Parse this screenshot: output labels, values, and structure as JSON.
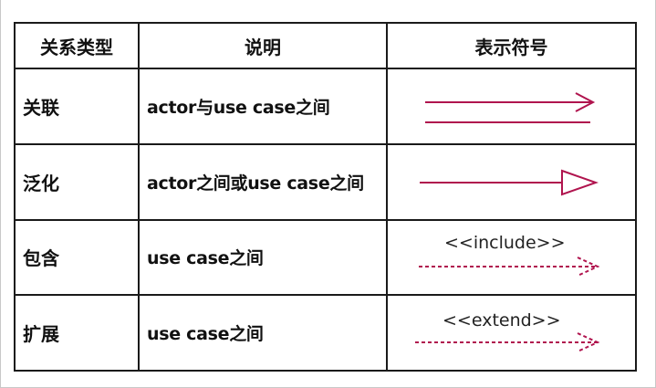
{
  "headers": [
    "关系类型",
    "说明",
    "表示符号"
  ],
  "rows": [
    {
      "type": "关联",
      "desc": "actor与use case之间",
      "symbol": "association",
      "stereotype": ""
    },
    {
      "type": "泛化",
      "desc": "actor之间或use case之间",
      "symbol": "generalization",
      "stereotype": ""
    },
    {
      "type": "包含",
      "desc": "use case之间",
      "symbol": "include",
      "stereotype": "<<include>>"
    },
    {
      "type": "扩展",
      "desc": "use case之间",
      "symbol": "extend",
      "stereotype": "<<extend>>"
    }
  ],
  "colors": {
    "line": "#b0144e",
    "border": "#1a1a1a"
  }
}
